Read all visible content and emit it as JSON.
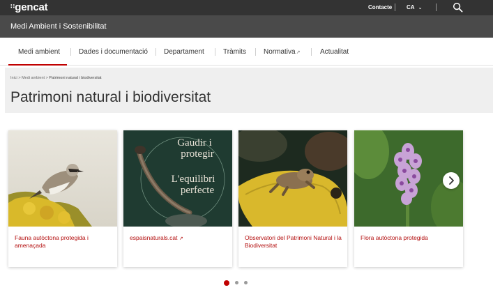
{
  "brand": {
    "logo_mark": "∷",
    "logo_text": "gencat"
  },
  "top": {
    "contact": "Contacte",
    "language": "CA"
  },
  "site": {
    "title": "Medi Ambient i Sostenibilitat"
  },
  "nav": {
    "items": [
      {
        "label": "Medi ambient",
        "active": true
      },
      {
        "label": "Dades i documentació"
      },
      {
        "label": "Departament"
      },
      {
        "label": "Tràmits"
      },
      {
        "label": "Normativa",
        "external": true
      },
      {
        "label": "Actualitat"
      }
    ]
  },
  "breadcrumb": {
    "home": "Inici",
    "sep": ">",
    "section": "Medi ambient",
    "current": "Patrimoni natural i biodiversitat"
  },
  "page": {
    "title": "Patrimoni natural i biodiversitat"
  },
  "cards": [
    {
      "label": "Fauna autòctona protegida i amenaçada"
    },
    {
      "label": "espaisnaturals.cat",
      "external": true,
      "image_text": [
        "Gaudir i",
        "protegir",
        "L'equilibri",
        "perfecte"
      ]
    },
    {
      "label": "Observatori del Patrimoni Natural i la Biodiversitat"
    },
    {
      "label": "Flora autòctona protegida"
    }
  ],
  "carousel": {
    "pages": 3,
    "active_page": 1
  },
  "colors": {
    "accent": "#c00000",
    "topbar": "#333333",
    "subbar": "#4a4a4a",
    "link": "#b30d0d"
  }
}
